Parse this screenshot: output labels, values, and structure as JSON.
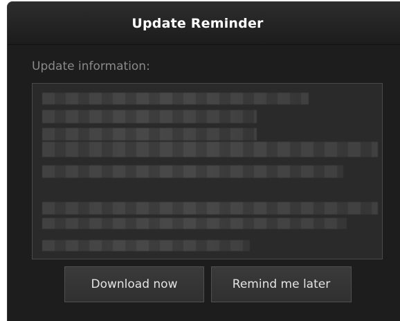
{
  "dialog": {
    "title": "Update Reminder",
    "section_label": "Update information:",
    "buttons": {
      "download_label": "Download now",
      "later_label": "Remind me later"
    }
  }
}
